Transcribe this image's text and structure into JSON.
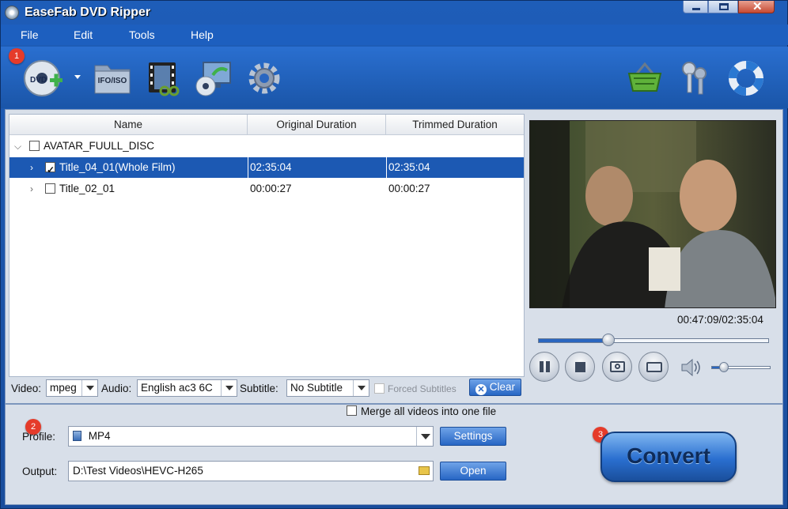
{
  "window": {
    "title": "EaseFab DVD Ripper"
  },
  "menu": {
    "file": "File",
    "edit": "Edit",
    "tools": "Tools",
    "help": "Help"
  },
  "badges": {
    "one": "1",
    "two": "2",
    "three": "3"
  },
  "toolbar": {
    "ifo_label": "IFO/ISO"
  },
  "list": {
    "columns": [
      "Name",
      "Original Duration",
      "Trimmed Duration"
    ],
    "disc": {
      "name": "AVATAR_FUULL_DISC",
      "checked": false
    },
    "rows": [
      {
        "name": "Title_04_01(Whole Film)",
        "original": "02:35:04",
        "trimmed": "02:35:04",
        "checked": true,
        "selected": true
      },
      {
        "name": "Title_02_01",
        "original": "00:00:27",
        "trimmed": "00:00:27",
        "checked": false,
        "selected": false
      }
    ]
  },
  "options": {
    "video_label": "Video:",
    "video_value": "mpeg",
    "audio_label": "Audio:",
    "audio_value": "English ac3 6C",
    "subtitle_label": "Subtitle:",
    "subtitle_value": "No Subtitle",
    "forced_label": "Forced Subtitles",
    "clear_label": "Clear"
  },
  "player": {
    "time": "00:47:09/02:35:04",
    "progress": 0.3043,
    "volume": 0.2
  },
  "output": {
    "merge_label": "Merge all videos into one file",
    "profile_label": "Profile:",
    "profile_value": "MP4",
    "settings_label": "Settings",
    "output_label": "Output:",
    "output_value": "D:\\Test Videos\\HEVC-H265",
    "open_label": "Open",
    "convert_label": "Convert"
  },
  "colors": {
    "accent": "#1c59b3",
    "badge": "#e53b2a",
    "frame": "#1a4d9c"
  }
}
